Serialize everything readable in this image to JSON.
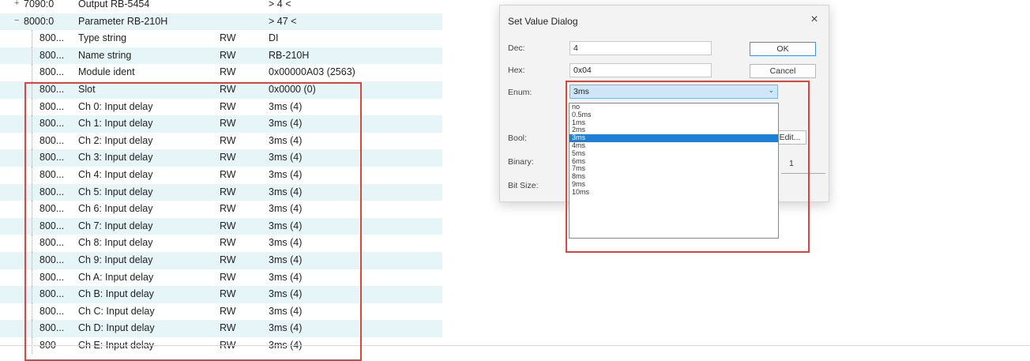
{
  "table": {
    "rows": [
      {
        "expander": "+",
        "index": "7090:0",
        "name": "Output RB-5454",
        "flag": "",
        "value": "> 4 <"
      },
      {
        "expander": "−",
        "index": "8000:0",
        "name": "Parameter RB-210H",
        "flag": "",
        "value": "> 47 <"
      },
      {
        "expander": "",
        "index": "800...",
        "name": "Type string",
        "flag": "RW",
        "value": "DI"
      },
      {
        "expander": "",
        "index": "800...",
        "name": "Name string",
        "flag": "RW",
        "value": "RB-210H"
      },
      {
        "expander": "",
        "index": "800...",
        "name": "Module ident",
        "flag": "RW",
        "value": "0x00000A03 (2563)"
      },
      {
        "expander": "",
        "index": "800...",
        "name": "Slot",
        "flag": "RW",
        "value": "0x0000 (0)"
      },
      {
        "expander": "",
        "index": "800...",
        "name": "Ch 0: Input delay",
        "flag": "RW",
        "value": "3ms (4)"
      },
      {
        "expander": "",
        "index": "800...",
        "name": "Ch 1: Input delay",
        "flag": "RW",
        "value": "3ms (4)"
      },
      {
        "expander": "",
        "index": "800...",
        "name": "Ch 2: Input delay",
        "flag": "RW",
        "value": "3ms (4)"
      },
      {
        "expander": "",
        "index": "800...",
        "name": "Ch 3: Input delay",
        "flag": "RW",
        "value": "3ms (4)"
      },
      {
        "expander": "",
        "index": "800...",
        "name": "Ch 4: Input delay",
        "flag": "RW",
        "value": "3ms (4)"
      },
      {
        "expander": "",
        "index": "800...",
        "name": "Ch 5: Input delay",
        "flag": "RW",
        "value": "3ms (4)"
      },
      {
        "expander": "",
        "index": "800...",
        "name": "Ch 6: Input delay",
        "flag": "RW",
        "value": "3ms (4)"
      },
      {
        "expander": "",
        "index": "800...",
        "name": "Ch 7: Input delay",
        "flag": "RW",
        "value": "3ms (4)"
      },
      {
        "expander": "",
        "index": "800...",
        "name": "Ch 8: Input delay",
        "flag": "RW",
        "value": "3ms (4)"
      },
      {
        "expander": "",
        "index": "800...",
        "name": "Ch 9: Input delay",
        "flag": "RW",
        "value": "3ms (4)"
      },
      {
        "expander": "",
        "index": "800...",
        "name": "Ch A: Input delay",
        "flag": "RW",
        "value": "3ms (4)"
      },
      {
        "expander": "",
        "index": "800...",
        "name": "Ch B: Input delay",
        "flag": "RW",
        "value": "3ms (4)"
      },
      {
        "expander": "",
        "index": "800...",
        "name": "Ch C: Input delay",
        "flag": "RW",
        "value": "3ms (4)"
      },
      {
        "expander": "",
        "index": "800...",
        "name": "Ch D: Input delay",
        "flag": "RW",
        "value": "3ms (4)"
      },
      {
        "expander": "",
        "index": "800",
        "name": "Ch E: Input delay",
        "flag": "RW",
        "value": "3ms (4)"
      }
    ]
  },
  "dialog": {
    "title": "Set Value Dialog",
    "close_glyph": "×",
    "dec_label": "Dec:",
    "dec_value": "4",
    "hex_label": "Hex:",
    "hex_value": "0x04",
    "enum_label": "Enum:",
    "enum_selected": "3ms",
    "enum_arrow_glyph": "⌄",
    "bool_label": "Bool:",
    "binary_label": "Binary:",
    "binary_value": "1",
    "bitsize_label": "Bit Size:",
    "ok_label": "OK",
    "cancel_label": "Cancel",
    "edit_label": "Edit..."
  },
  "enum_options": [
    "no",
    "0.5ms",
    "1ms",
    "2ms",
    "3ms",
    "4ms",
    "5ms",
    "6ms",
    "7ms",
    "8ms",
    "9ms",
    "10ms"
  ],
  "enum_selected_index": 4,
  "colors": {
    "row_alt": "#e6f5f8",
    "highlight": "#d9463f",
    "selection": "#1e7fd6"
  }
}
